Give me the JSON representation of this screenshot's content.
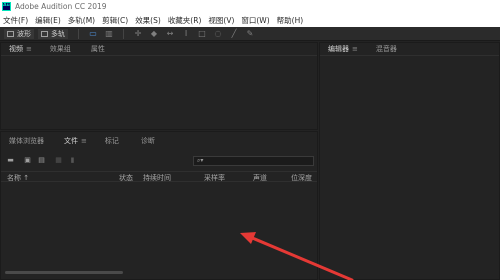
{
  "app": {
    "title": "Adobe Audition CC 2019",
    "logo_text": "Au"
  },
  "menu": [
    "文件(F)",
    "编辑(E)",
    "多轨(M)",
    "剪辑(C)",
    "效果(S)",
    "收藏夹(R)",
    "视图(V)",
    "窗口(W)",
    "帮助(H)"
  ],
  "toolbar": {
    "waveform_label": "波形",
    "multitrack_label": "多轨"
  },
  "top_left_panel": {
    "tabs": [
      "视频",
      "效果组",
      "属性"
    ]
  },
  "bottom_left_panel": {
    "tabs": [
      "媒体浏览器",
      "文件",
      "标记",
      "诊断"
    ],
    "search_placeholder": "",
    "columns": [
      "名称 ↑",
      "状态",
      "持续时间",
      "采样率",
      "声道",
      "位深度"
    ]
  },
  "right_panel": {
    "tabs": [
      "编辑器",
      "混音器"
    ]
  },
  "colors": {
    "arrow": "#e53935",
    "accent": "#4f8fd8"
  }
}
